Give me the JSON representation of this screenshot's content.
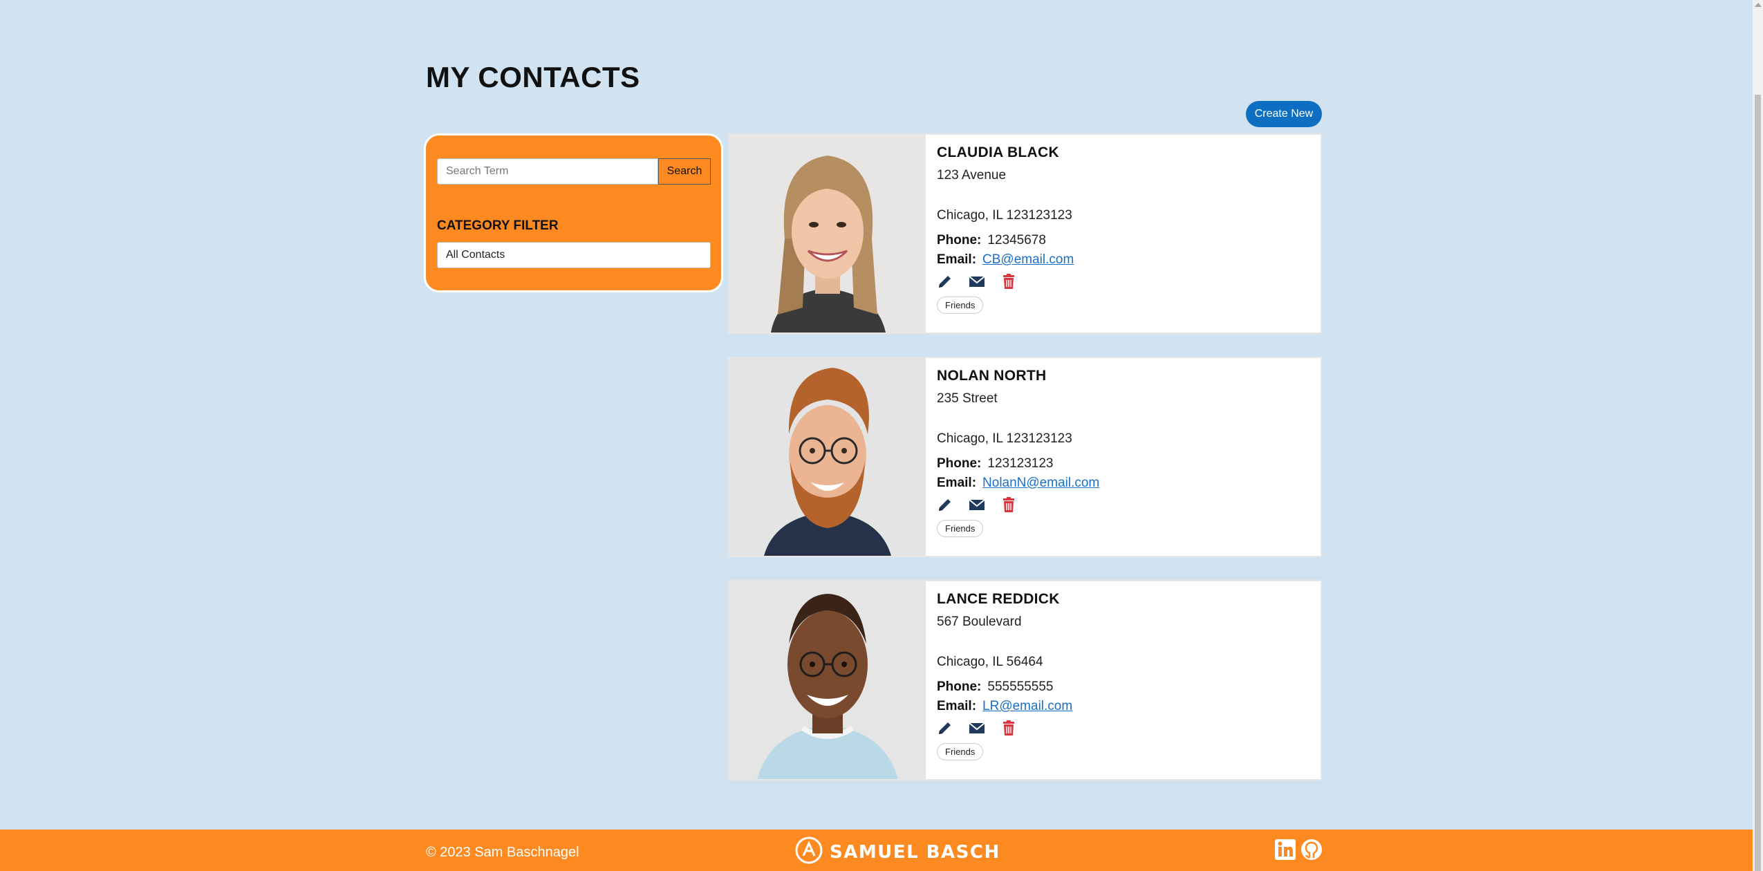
{
  "page": {
    "title": "MY CONTACTS"
  },
  "toolbar": {
    "create_label": "Create New"
  },
  "sidebar": {
    "search_placeholder": "Search Term",
    "search_value": "",
    "search_button": "Search",
    "category_label": "CATEGORY FILTER",
    "category_selected": "All Contacts"
  },
  "contacts": [
    {
      "name": "CLAUDIA BLACK",
      "address_line1": "123 Avenue",
      "address_line2": "Chicago, IL 123123123",
      "phone_label": "Phone:",
      "phone": "12345678",
      "email_label": "Email:",
      "email": "CB@email.com",
      "category": "Friends"
    },
    {
      "name": "NOLAN NORTH",
      "address_line1": "235 Street",
      "address_line2": "Chicago, IL 123123123",
      "phone_label": "Phone:",
      "phone": "123123123",
      "email_label": "Email:",
      "email": "NolanN@email.com",
      "category": "Friends"
    },
    {
      "name": "LANCE REDDICK",
      "address_line1": "567 Boulevard",
      "address_line2": "Chicago, IL 56464",
      "phone_label": "Phone:",
      "phone": "555555555",
      "email_label": "Email:",
      "email": "LR@email.com",
      "category": "Friends"
    }
  ],
  "icons": {
    "edit": "pencil-icon",
    "email": "envelope-icon",
    "delete": "trash-icon",
    "linkedin": "linkedin-icon",
    "github": "github-icon",
    "logo": "logo-icon"
  },
  "colors": {
    "background": "#d1e3f1",
    "accent": "#fd8a21",
    "primary": "#0d6ec2",
    "icon_dark": "#1f3a5c",
    "delete": "#d9363e"
  },
  "footer": {
    "copyright": "© 2023 Sam Baschnagel",
    "brand": "SAMUEL BASCH"
  }
}
